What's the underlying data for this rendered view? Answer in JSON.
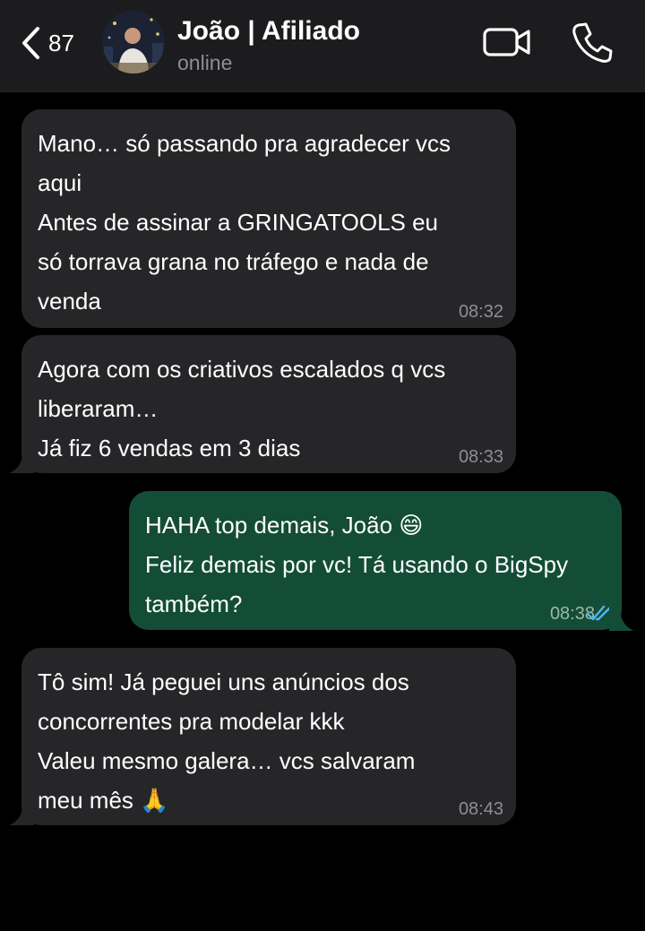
{
  "header": {
    "unread_count": "87",
    "contact_name": "João | Afiliado",
    "status": "online"
  },
  "messages": [
    {
      "direction": "incoming",
      "lines": [
        "Mano… só passando pra agradecer vcs",
        "aqui",
        "Antes de assinar a GRINGATOOLS eu",
        "só torrava grana no tráfego e nada de",
        "venda"
      ],
      "time": "08:32"
    },
    {
      "direction": "incoming",
      "lines": [
        "Agora com os criativos escalados q vcs",
        "liberaram…",
        "Já fiz 6 vendas em 3 dias"
      ],
      "time": "08:33"
    },
    {
      "direction": "outgoing",
      "lines": [
        "HAHA top demais, João 😄",
        "Feliz demais por vc! Tá usando o BigSpy",
        "também?"
      ],
      "time": "08:38",
      "read": true
    },
    {
      "direction": "incoming",
      "lines": [
        "Tô sim! Já peguei uns anúncios dos",
        "concorrentes pra modelar kkk",
        "Valeu mesmo galera… vcs salvaram",
        "meu mês 🙏"
      ],
      "time": "08:43"
    }
  ],
  "icons": {
    "back": "chevron-left-icon",
    "video": "video-camera-icon",
    "call": "phone-icon",
    "read_receipt": "double-check-icon"
  },
  "colors": {
    "header_bg": "#1c1c1e",
    "incoming_bubble": "#262628",
    "outgoing_bubble": "#144d37",
    "read_ticks": "#4fb6ec"
  }
}
